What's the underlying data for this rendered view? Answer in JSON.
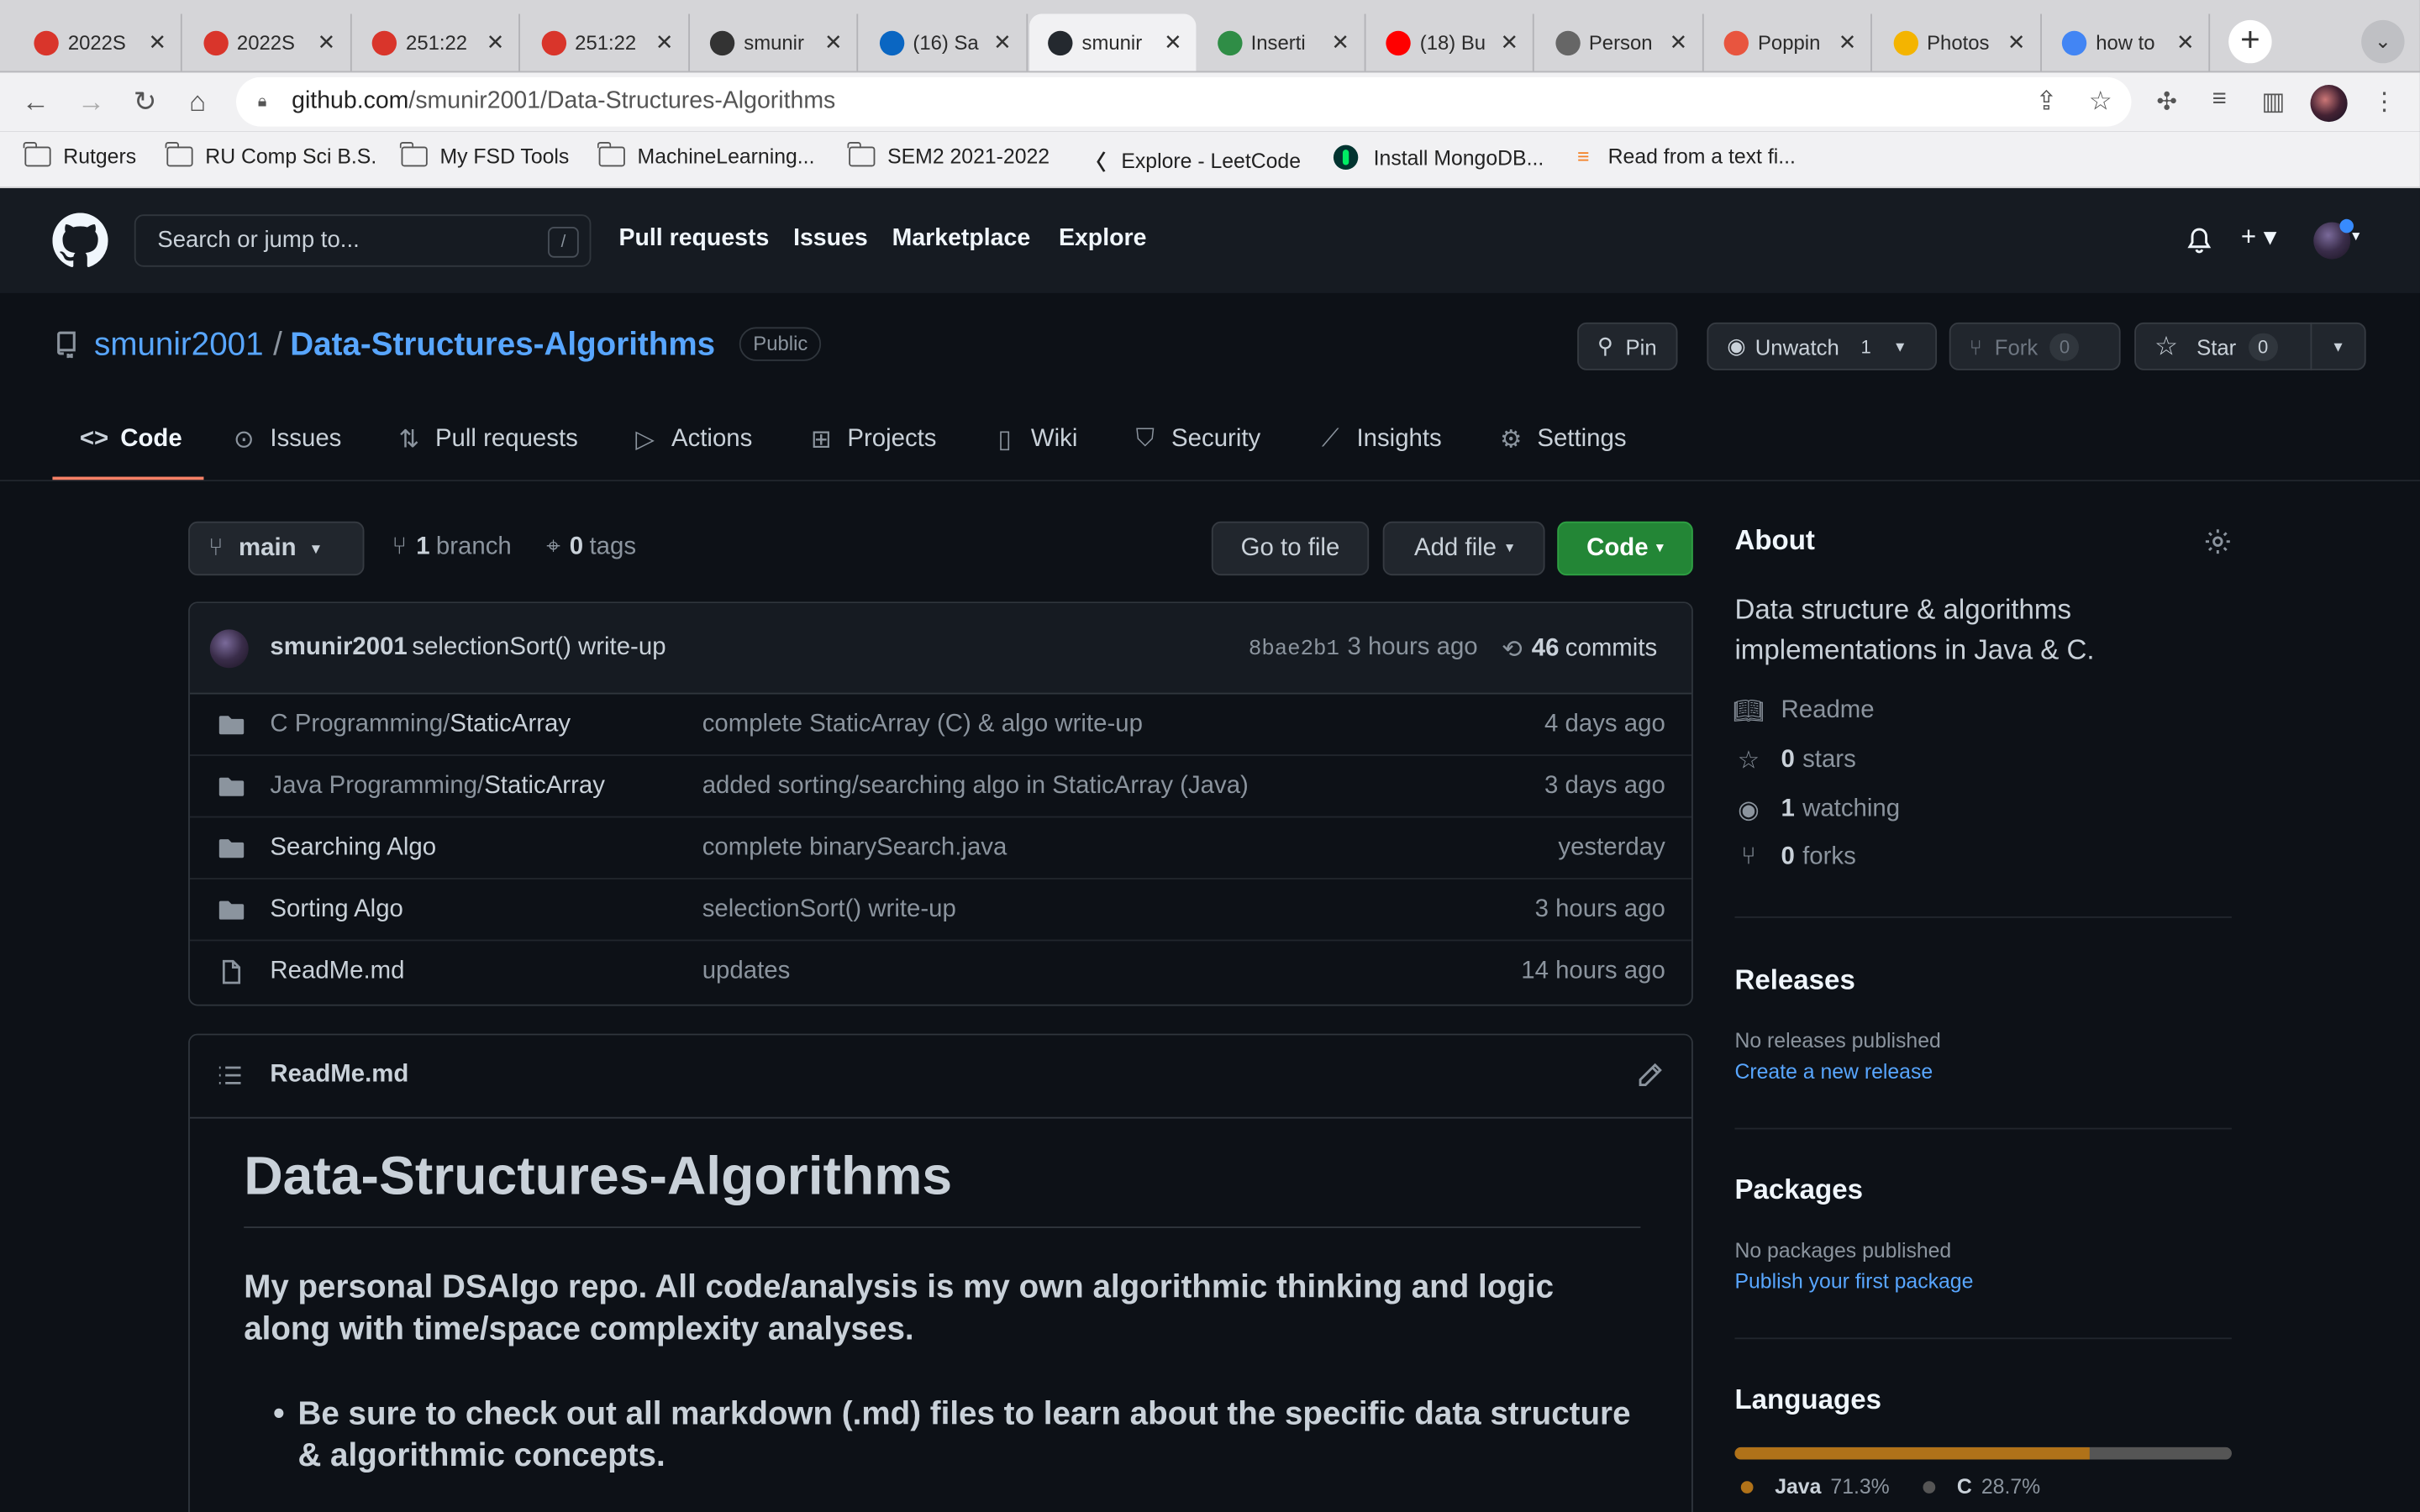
{
  "browser": {
    "tabs": [
      {
        "title": "2022S",
        "icon": "rutgers-favicon",
        "color": "#d9352b"
      },
      {
        "title": "2022S",
        "icon": "rutgers-favicon",
        "color": "#d9352b"
      },
      {
        "title": "251:22",
        "icon": "rutgers-favicon",
        "color": "#d9352b"
      },
      {
        "title": "251:22",
        "icon": "rutgers-favicon",
        "color": "#d9352b"
      },
      {
        "title": "smunir",
        "icon": "leetcode-favicon",
        "color": "#333333"
      },
      {
        "title": "(16) Sa",
        "icon": "linkedin-favicon",
        "color": "#0a66c2"
      },
      {
        "title": "smunir",
        "icon": "github-favicon",
        "color": "#24292f"
      },
      {
        "title": "Inserti",
        "icon": "geeksforgeeks-favicon",
        "color": "#2f8d46"
      },
      {
        "title": "(18) Bu",
        "icon": "youtube-favicon",
        "color": "#ff0000"
      },
      {
        "title": "Person",
        "icon": "globe-favicon",
        "color": "#666666"
      },
      {
        "title": "Poppin",
        "icon": "app-favicon",
        "color": "#e8553f"
      },
      {
        "title": "Photos",
        "icon": "google-photos-favicon",
        "color": "#f4b400"
      },
      {
        "title": "how to",
        "icon": "google-favicon",
        "color": "#4285f4"
      }
    ],
    "url_host": "github.com",
    "url_path": "/smunir2001/Data-Structures-Algorithms",
    "bookmarks": [
      {
        "label": "Rutgers",
        "icon": "folder-icon"
      },
      {
        "label": "RU Comp Sci B.S.",
        "icon": "folder-icon"
      },
      {
        "label": "My FSD Tools",
        "icon": "folder-icon"
      },
      {
        "label": "MachineLearning...",
        "icon": "folder-icon"
      },
      {
        "label": "SEM2 2021-2022",
        "icon": "folder-icon"
      },
      {
        "label": "Explore - LeetCode",
        "icon": "leetcode-icon"
      },
      {
        "label": "Install MongoDB...",
        "icon": "mongodb-icon"
      },
      {
        "label": "Read from a text fi...",
        "icon": "stackoverflow-icon"
      }
    ]
  },
  "github": {
    "search_placeholder": "Search or jump to...",
    "search_shortcut": "/",
    "nav": [
      "Pull requests",
      "Issues",
      "Marketplace",
      "Explore"
    ]
  },
  "repo": {
    "owner": "smunir2001",
    "separator": "/",
    "name": "Data-Structures-Algorithms",
    "visibility": "Public",
    "pin_label": "Pin",
    "watch_label": "Unwatch",
    "watch_count": "1",
    "fork_label": "Fork",
    "fork_count": "0",
    "star_label": "Star",
    "star_count": "0",
    "tabs": [
      "Code",
      "Issues",
      "Pull requests",
      "Actions",
      "Projects",
      "Wiki",
      "Security",
      "Insights",
      "Settings"
    ],
    "branch": "main",
    "branch_count": "1",
    "branch_label": "branch",
    "tag_count": "0",
    "tag_label": "tags",
    "go_to_file": "Go to file",
    "add_file": "Add file",
    "code_button": "Code"
  },
  "latest_commit": {
    "author": "smunir2001",
    "message": "selectionSort() write-up",
    "sha": "8bae2b1",
    "ago": "3 hours ago",
    "commit_count": "46",
    "commit_label": "commits"
  },
  "files": [
    {
      "type": "dir",
      "dim": "C Programming/",
      "name": "StaticArray",
      "message": "complete StaticArray (C) & algo write-up",
      "ago": "4 days ago"
    },
    {
      "type": "dir",
      "dim": "Java Programming/",
      "name": "StaticArray",
      "message": "added sorting/searching algo in StaticArray (Java)",
      "ago": "3 days ago"
    },
    {
      "type": "dir",
      "dim": "",
      "name": "Searching Algo",
      "message": "complete binarySearch.java",
      "ago": "yesterday"
    },
    {
      "type": "dir",
      "dim": "",
      "name": "Sorting Algo",
      "message": "selectionSort() write-up",
      "ago": "3 hours ago"
    },
    {
      "type": "file",
      "dim": "",
      "name": "ReadMe.md",
      "message": "updates",
      "ago": "14 hours ago"
    }
  ],
  "readme": {
    "filename": "ReadMe.md",
    "h1": "Data-Structures-Algorithms",
    "intro": "My personal DSAlgo repo. All code/analysis is my own algorithmic thinking and logic along with time/space complexity analyses.",
    "bullet": "Be sure to check out all markdown (.md) files to learn about the specific data structure & algorithmic concepts."
  },
  "about": {
    "heading": "About",
    "description": "Data structure & algorithms implementations in Java & C.",
    "readme_label": "Readme",
    "stars_count": "0",
    "stars_label": "stars",
    "watching_count": "1",
    "watching_label": "watching",
    "forks_count": "0",
    "forks_label": "forks"
  },
  "releases": {
    "heading": "Releases",
    "empty": "No releases published",
    "link": "Create a new release"
  },
  "packages": {
    "heading": "Packages",
    "empty": "No packages published",
    "link": "Publish your first package"
  },
  "languages": {
    "heading": "Languages",
    "items": [
      {
        "name": "Java",
        "percent": "71.3%",
        "value": 71.3,
        "color": "#b07219"
      },
      {
        "name": "C",
        "percent": "28.7%",
        "value": 28.7,
        "color": "#555555"
      }
    ]
  }
}
